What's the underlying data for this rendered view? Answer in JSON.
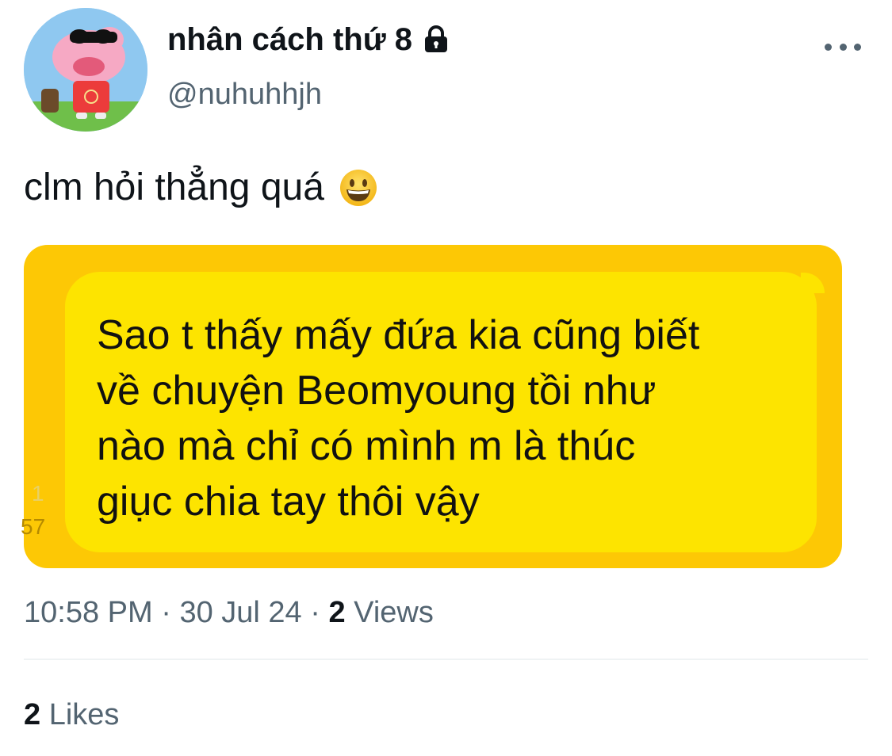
{
  "author": {
    "display_name": "nhân cách thứ 8",
    "handle": "@nuhuhhjh",
    "avatar_icon": "pig-avatar",
    "lock_icon": "lock-icon"
  },
  "tweet": {
    "text": "clm hỏi thẳng quá",
    "emoji_icon": "grinning-face-icon"
  },
  "media": {
    "side_numbers": [
      "1",
      "57"
    ],
    "message_lines": [
      "Sao t thấy mấy đứa kia cũng biết",
      "về chuyện Beomyoung tồi như",
      "nào mà chỉ có mình m là thúc",
      "giục chia tay thôi vậy"
    ],
    "colors": {
      "frame": "#fdc805",
      "bubble": "#fde400"
    }
  },
  "meta": {
    "time": "10:58 PM",
    "separator": "·",
    "date": "30 Jul 24",
    "views_count": "2",
    "views_label": "Views"
  },
  "stats": {
    "likes_count": "2",
    "likes_label": "Likes"
  }
}
